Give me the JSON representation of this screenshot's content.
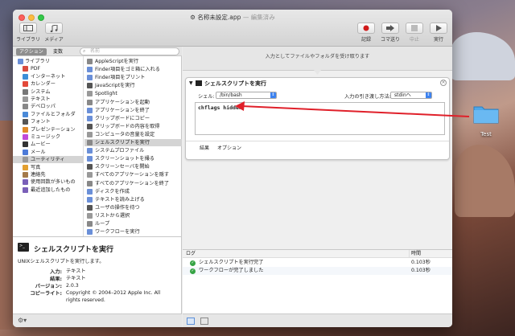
{
  "window": {
    "filename": "名称未設定.app",
    "edited": "— 編集済み"
  },
  "toolbar": {
    "library": "ライブラリ",
    "media": "メディア",
    "record": "記録",
    "step": "コマ送り",
    "stop": "中止",
    "run": "実行"
  },
  "tabs": {
    "actions": "アクション",
    "variables": "変数"
  },
  "search": {
    "placeholder": "名前"
  },
  "library": [
    "ライブラリ",
    "PDF",
    "インターネット",
    "カレンダー",
    "システム",
    "テキスト",
    "デベロッパ",
    "ファイルとフォルダ",
    "フォント",
    "プレゼンテーション",
    "ミュージック",
    "ムービー",
    "メール",
    "ユーティリティ",
    "写真",
    "連絡先",
    "使用回数が多いもの",
    "最近追加したもの"
  ],
  "actions": [
    "AppleScriptを実行",
    "Finder項目をゴミ箱に入れる",
    "Finder項目をプリント",
    "JavaScriptを実行",
    "Spotlight",
    "アプリケーションを起動",
    "アプリケーションを終了",
    "クリップボードにコピー",
    "クリップボードの内容を取得",
    "コンピュータの音量を設定",
    "シェルスクリプトを実行",
    "システムプロファイル",
    "スクリーンショットを撮る",
    "スクリーンセーバを開始",
    "すべてのアプリケーションを隠す",
    "すべてのアプリケーションを終了",
    "ディスクを作成",
    "テキストを読み上げる",
    "ユーザの操作を待つ",
    "リストから選択",
    "ループ",
    "ワークフローを実行"
  ],
  "description": {
    "title": "シェルスクリプトを実行",
    "summary": "UNIXシェルスクリプトを実行します。",
    "rows": [
      {
        "k": "入力:",
        "v": "テキスト"
      },
      {
        "k": "結果:",
        "v": "テキスト"
      },
      {
        "k": "バージョン:",
        "v": "2.0.3"
      },
      {
        "k": "コピーライト:",
        "v": "Copyright © 2004–2012 Apple Inc.  All rights reserved."
      }
    ]
  },
  "workflow": {
    "input_hint": "入力としてファイルやフォルダを受け取ります",
    "card": {
      "title": "シェルスクリプトを実行",
      "shell_label": "シェル:",
      "shell_value": "/bin/bash",
      "pass_label": "入力の引き渡し方法:",
      "pass_value": "stdinへ",
      "script": "chflags hidden",
      "tab_results": "結果",
      "tab_options": "オプション"
    }
  },
  "log": {
    "col_log": "ログ",
    "col_time": "時間",
    "rows": [
      {
        "text": "シェルスクリプトを実行完了",
        "time": "0.103秒"
      },
      {
        "text": "ワークフローが完了しました",
        "time": "0.103秒"
      }
    ]
  },
  "desktop": {
    "folder_name": "Test"
  },
  "colors": {
    "accent": "#3c82f0",
    "arrow": "#e0202a"
  }
}
